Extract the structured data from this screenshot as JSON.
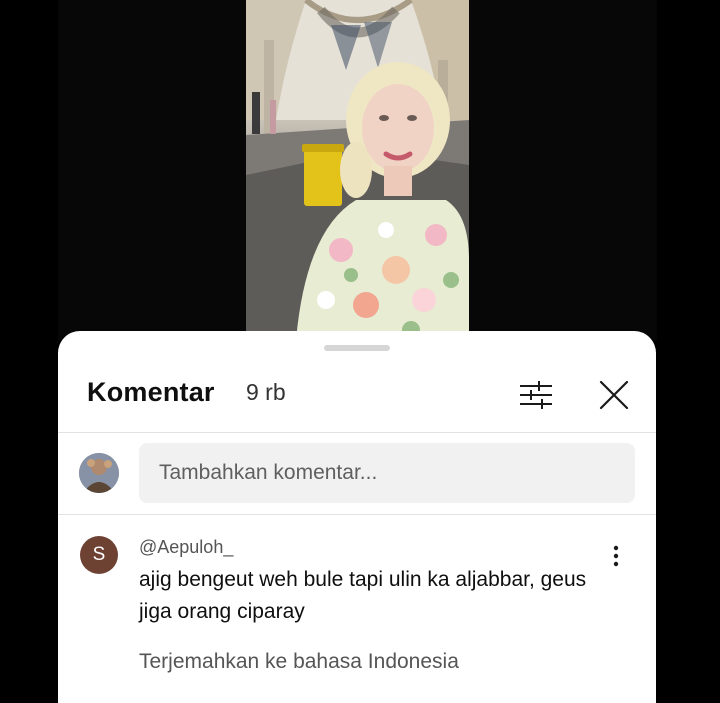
{
  "comments_panel": {
    "title": "Komentar",
    "count": "9 rb",
    "filter_icon": "sliders-icon",
    "close_icon": "close-icon"
  },
  "composer": {
    "placeholder": "Tambahkan komentar..."
  },
  "comments": [
    {
      "avatar_letter": "S",
      "avatar_color": "#6d4233",
      "author": "@Aepuloh_",
      "text": "ajig bengeut weh bule tapi ulin ka aljabbar, geus jiga orang ciparay",
      "translate_label": "Terjemahkan ke bahasa Indonesia",
      "menu_icon": "more-vert-icon"
    }
  ]
}
